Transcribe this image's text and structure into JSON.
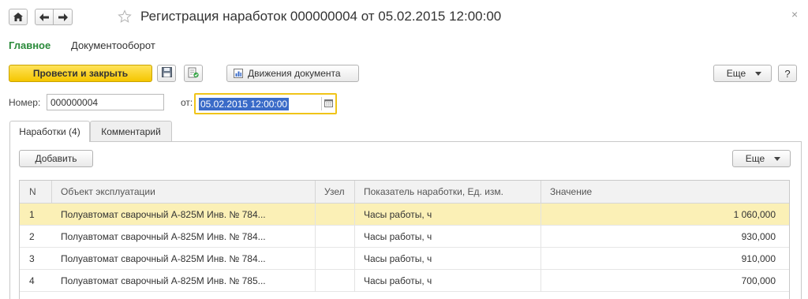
{
  "window": {
    "title": "Регистрация наработок 000000004 от 05.02.2015 12:00:00",
    "close_glyph": "×"
  },
  "nav": {
    "home_icon": "home-icon",
    "back_icon": "arrow-left-icon",
    "forward_icon": "arrow-right-icon",
    "favorite_icon": "star-outline-icon"
  },
  "menu": {
    "items": [
      {
        "label": "Главное",
        "active": true
      },
      {
        "label": "Документооборот",
        "active": false
      }
    ]
  },
  "toolbar": {
    "post_close_label": "Провести и закрыть",
    "save_icon": "floppy-disk-icon",
    "post_icon": "post-document-icon",
    "movements_label": "Движения документа",
    "movements_icon": "register-movements-icon",
    "more_label": "Еще",
    "help_label": "?"
  },
  "fields": {
    "number_label": "Номер:",
    "number_value": "000000004",
    "date_label": "от:",
    "date_value": "05.02.2015 12:00:00",
    "date_icon": "calendar-icon"
  },
  "tabs": [
    {
      "label": "Наработки (4)",
      "active": true
    },
    {
      "label": "Комментарий",
      "active": false
    }
  ],
  "table_toolbar": {
    "add_label": "Добавить",
    "more_label": "Еще"
  },
  "table": {
    "columns": [
      "N",
      "Объект эксплуатации",
      "Узел",
      "Показатель наработки, Ед. изм.",
      "Значение"
    ],
    "rows": [
      {
        "n": "1",
        "object": "Полуавтомат сварочный А-825М   Инв. № 784...",
        "node": "",
        "indicator": "Часы работы, ч",
        "value": "1 060,000",
        "selected": true
      },
      {
        "n": "2",
        "object": "Полуавтомат сварочный А-825М   Инв. № 784...",
        "node": "",
        "indicator": "Часы работы, ч",
        "value": "930,000",
        "selected": false
      },
      {
        "n": "3",
        "object": "Полуавтомат сварочный А-825М   Инв. № 784...",
        "node": "",
        "indicator": "Часы работы, ч",
        "value": "910,000",
        "selected": false
      },
      {
        "n": "4",
        "object": "Полуавтомат сварочный А-825М   Инв. № 785...",
        "node": "",
        "indicator": "Часы работы, ч",
        "value": "700,000",
        "selected": false
      }
    ]
  },
  "colors": {
    "accent_green": "#2a8a3a",
    "primary_button": "#f5c600",
    "selected_row": "#fbf0b6",
    "date_focus_border": "#f0c419"
  }
}
